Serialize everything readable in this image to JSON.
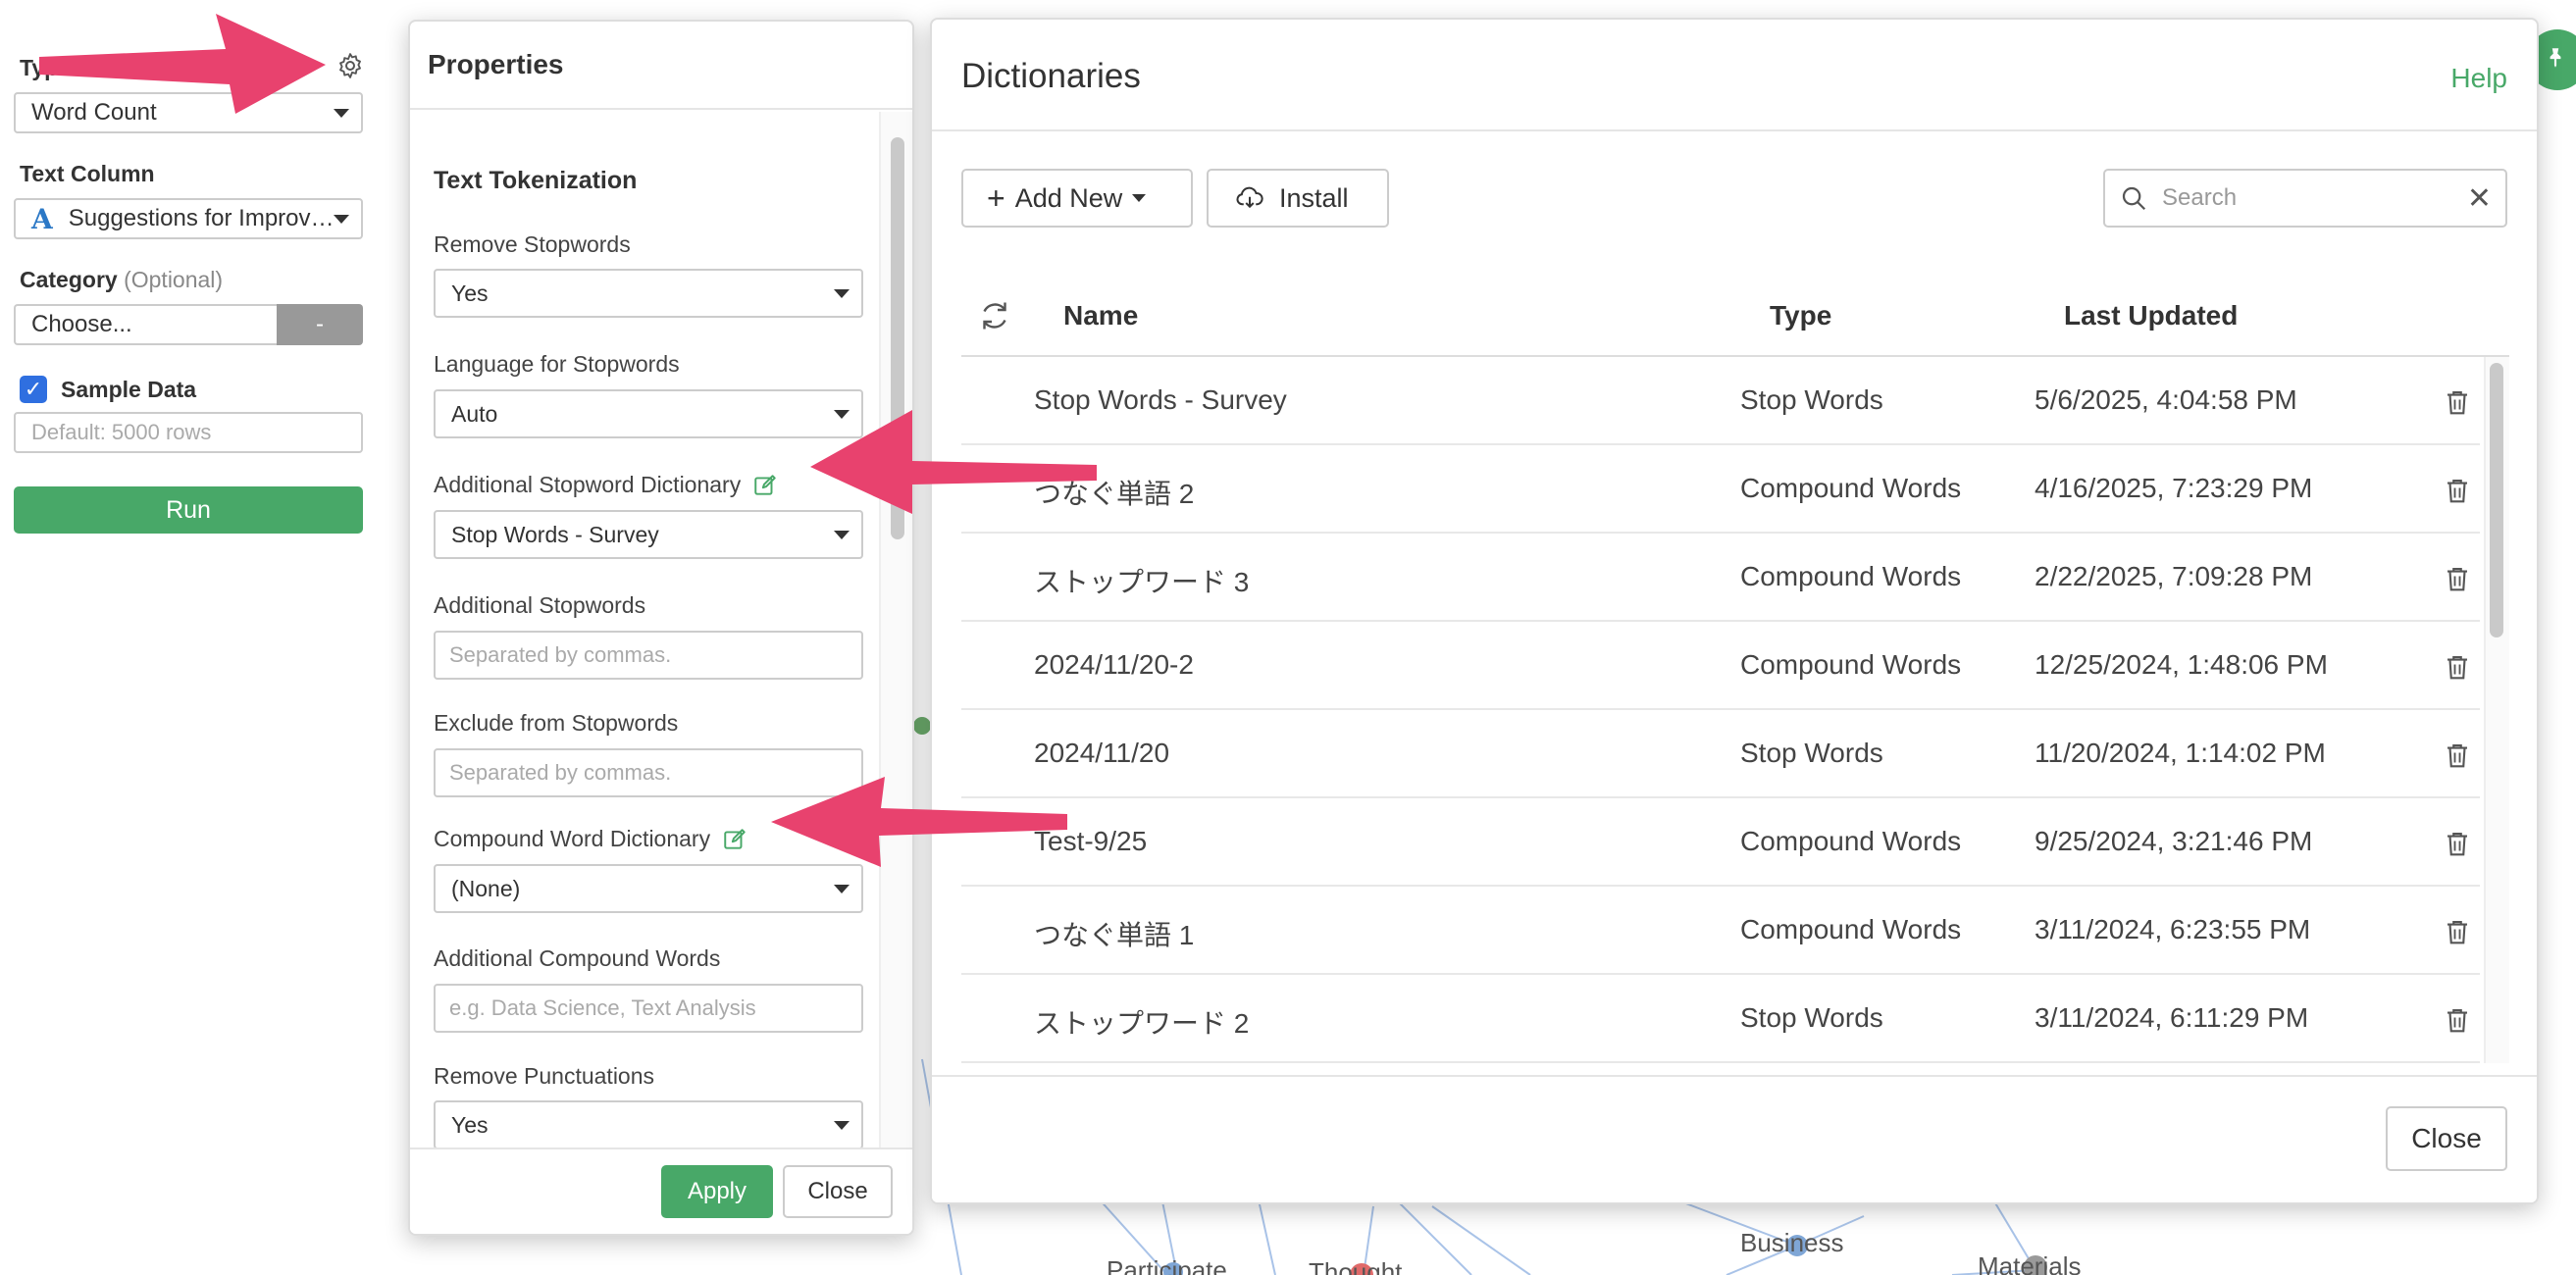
{
  "sidebar": {
    "type_label": "Type",
    "type_value": "Word Count",
    "text_column_label": "Text Column",
    "text_column_value": "Suggestions for Improv…",
    "category_label": "Category",
    "category_optional": "(Optional)",
    "category_value": "Choose...",
    "category_clear": "-",
    "sample_data_label": "Sample Data",
    "sample_data_checked": true,
    "sample_rows_placeholder": "Default: 5000 rows",
    "run_label": "Run"
  },
  "properties": {
    "title": "Properties",
    "section_title": "Text Tokenization",
    "remove_stopwords_label": "Remove Stopwords",
    "remove_stopwords_value": "Yes",
    "language_label": "Language for Stopwords",
    "language_value": "Auto",
    "additional_dict_label": "Additional Stopword Dictionary",
    "additional_dict_value": "Stop Words - Survey",
    "additional_stopwords_label": "Additional Stopwords",
    "additional_stopwords_placeholder": "Separated by commas.",
    "exclude_label": "Exclude from Stopwords",
    "exclude_placeholder": "Separated by commas.",
    "compound_dict_label": "Compound Word Dictionary",
    "compound_dict_value": "(None)",
    "additional_compound_label": "Additional Compound Words",
    "additional_compound_placeholder": "e.g. Data Science, Text Analysis",
    "remove_punct_label": "Remove Punctuations",
    "remove_punct_value": "Yes",
    "apply_label": "Apply",
    "close_label": "Close"
  },
  "dictionaries": {
    "title": "Dictionaries",
    "help_label": "Help",
    "add_new_label": "Add New",
    "install_label": "Install",
    "search_placeholder": "Search",
    "columns": {
      "name": "Name",
      "type": "Type",
      "last_updated": "Last Updated"
    },
    "rows": [
      {
        "name": "Stop Words - Survey",
        "type": "Stop Words",
        "updated": "5/6/2025, 4:04:58 PM"
      },
      {
        "name": "つなぐ単語 2",
        "type": "Compound Words",
        "updated": "4/16/2025, 7:23:29 PM"
      },
      {
        "name": "ストップワード 3",
        "type": "Compound Words",
        "updated": "2/22/2025, 7:09:28 PM"
      },
      {
        "name": "2024/11/20-2",
        "type": "Compound Words",
        "updated": "12/25/2024, 1:48:06 PM"
      },
      {
        "name": "2024/11/20",
        "type": "Stop Words",
        "updated": "11/20/2024, 1:14:02 PM"
      },
      {
        "name": "Test-9/25",
        "type": "Compound Words",
        "updated": "9/25/2024, 3:21:46 PM"
      },
      {
        "name": "つなぐ単語 1",
        "type": "Compound Words",
        "updated": "3/11/2024, 6:23:55 PM"
      },
      {
        "name": "ストップワード 2",
        "type": "Stop Words",
        "updated": "3/11/2024, 6:11:29 PM"
      }
    ],
    "close_label": "Close"
  },
  "background": {
    "words": [
      "Business",
      "Materials",
      "Participate",
      "Thought"
    ]
  },
  "colors": {
    "accent_green": "#48a868",
    "checkbox_blue": "#2f6fe0",
    "annotation_arrow": "#e8426e",
    "graph_edge": "#a9c3e8"
  },
  "icons": {
    "settings": "gear-icon",
    "edit": "edit-icon",
    "refresh": "refresh-icon",
    "delete": "trash-icon",
    "search": "search-icon",
    "clear": "close-icon",
    "install": "cloud-download-icon",
    "add": "plus-icon",
    "pin": "pin-icon"
  }
}
